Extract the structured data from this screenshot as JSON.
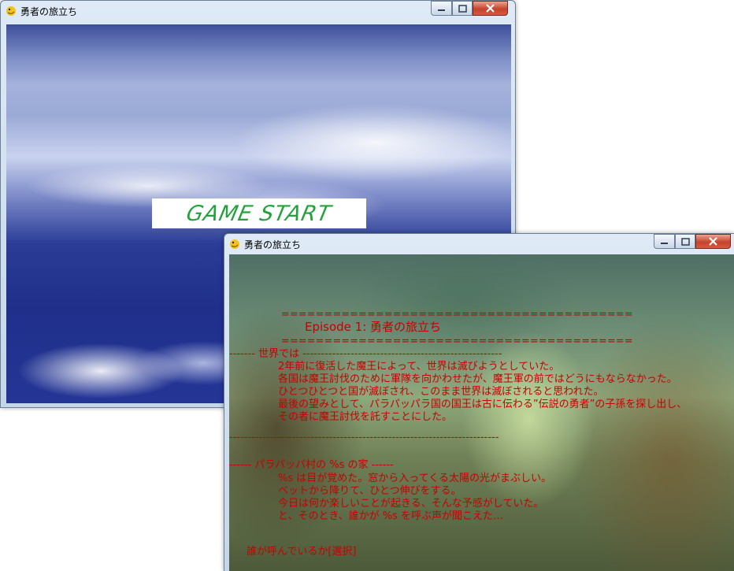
{
  "window1": {
    "title": "勇者の旅立ち",
    "start_button": "GAME START"
  },
  "window2": {
    "title": "勇者の旅立ち",
    "story": {
      "rule_top": "=========================================",
      "episode_title": "Episode 1: 勇者の旅立ち",
      "rule_bottom": "=========================================",
      "section1_heading": "------- 世界では ------------------------------------------------------",
      "section1_lines": [
        "2年前に復活した魔王によって、世界は滅びようとしていた。",
        "各国は魔王討伐のために軍隊を向かわせたが、魔王軍の前ではどうにもならなかった。",
        "ひとつひとつと国が滅ぼされ、このまま世界は滅ぼされると思われた。",
        "最後の望みとして、パラパッパラ国の国王は古に伝わる”伝説の勇者”の子孫を探し出し、",
        "その者に魔王討伐を託すことにした。"
      ],
      "section1_rule": "-------------------------------------------------------------------------",
      "section2_heading": "------ パラパッパ村の %s の家 ------",
      "section2_lines": [
        "%s は目が覚めた。窓から入ってくる太陽の光がまぶしい。",
        "ベットから降りて、ひとつ伸びをする。",
        "今日は何か楽しいことが起きる、そんな予感がしていた。",
        "と、そのとき、誰かが %s を呼ぶ声が聞こえた…"
      ],
      "choice": "誰が呼んでいるか[選択]"
    }
  },
  "colors": {
    "story_text": "#c80000",
    "start_text": "#23a23c"
  }
}
